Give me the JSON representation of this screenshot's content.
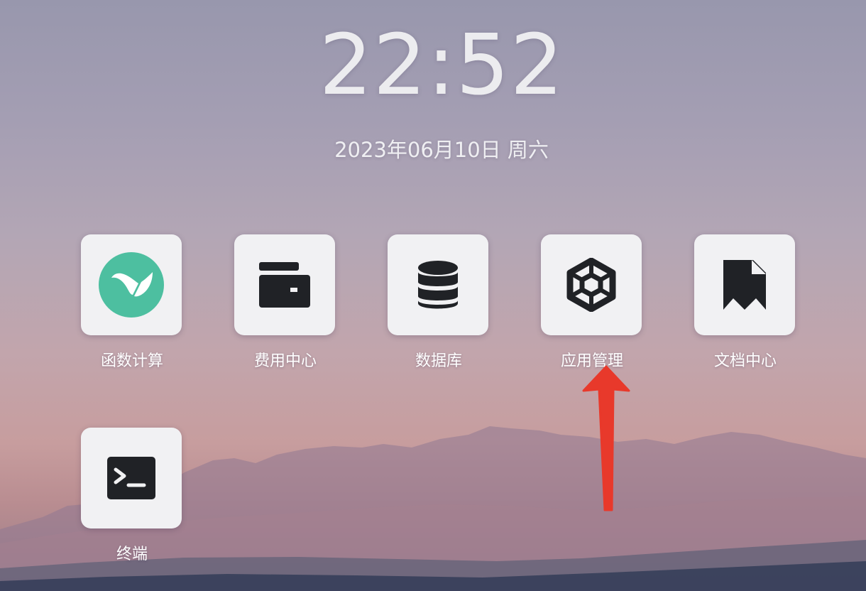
{
  "clock": {
    "time": "22:52"
  },
  "date": {
    "text": "2023年06月10日 周六"
  },
  "apps": [
    {
      "label": "函数计算",
      "icon": "function-compute-icon"
    },
    {
      "label": "费用中心",
      "icon": "wallet-icon"
    },
    {
      "label": "数据库",
      "icon": "database-icon"
    },
    {
      "label": "应用管理",
      "icon": "hexagon-app-icon"
    },
    {
      "label": "文档中心",
      "icon": "bookmark-document-icon"
    },
    {
      "label": "终端",
      "icon": "terminal-icon"
    }
  ],
  "colors": {
    "tile_background": "#f1f1f3",
    "icon_dark": "#202226",
    "function_compute_accent": "#4dbfa0",
    "arrow": "#e8392b"
  }
}
